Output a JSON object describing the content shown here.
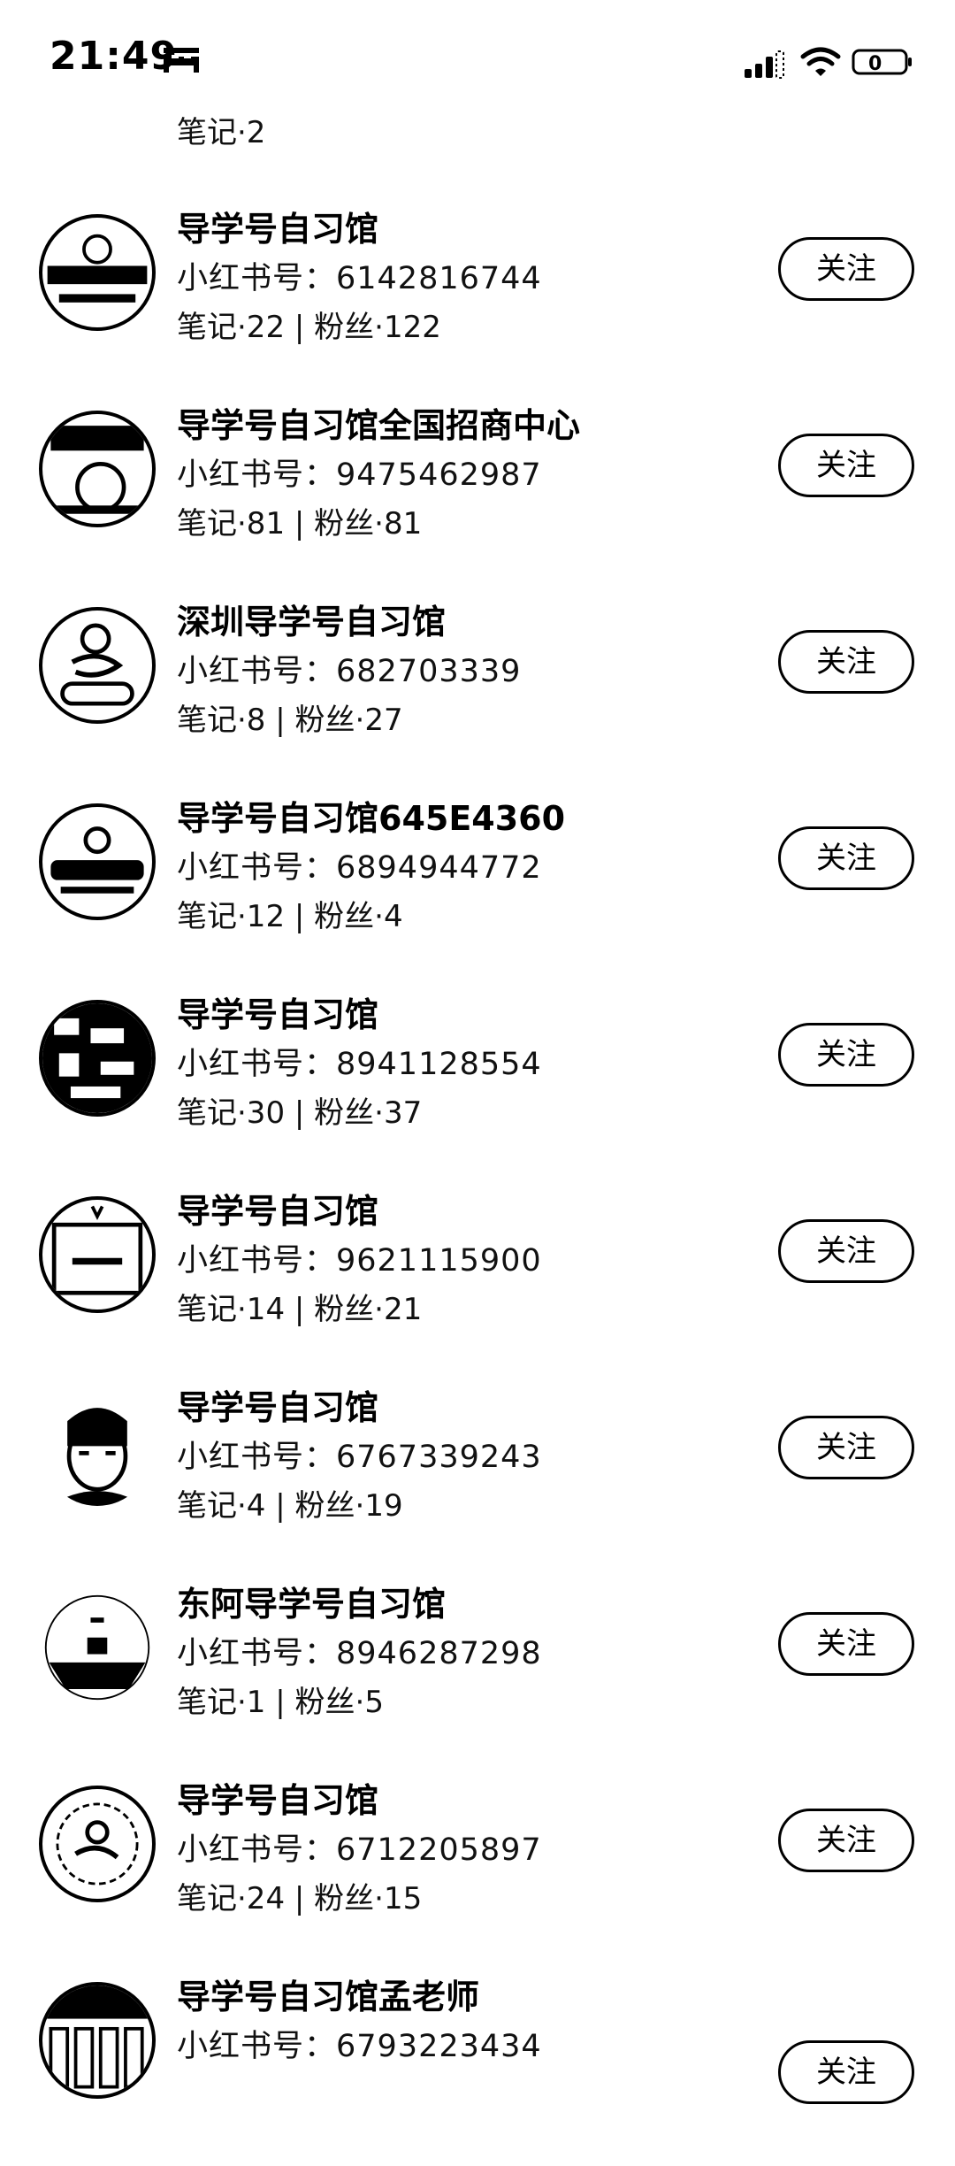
{
  "status_bar": {
    "time": "21:49",
    "battery": "0"
  },
  "partial_item": {
    "stats": "笔记·2"
  },
  "follow_label": "关注",
  "users": [
    {
      "name": "导学号自习馆",
      "red_id": "小红书号：6142816744",
      "stats": "笔记·22 | 粉丝·122"
    },
    {
      "name": "导学号自习馆全国招商中心",
      "red_id": "小红书号：9475462987",
      "stats": "笔记·81 | 粉丝·81"
    },
    {
      "name": "深圳导学号自习馆",
      "red_id": "小红书号：682703339",
      "stats": "笔记·8 | 粉丝·27"
    },
    {
      "name": "导学号自习馆645E4360",
      "red_id": "小红书号：6894944772",
      "stats": "笔记·12 | 粉丝·4"
    },
    {
      "name": "导学号自习馆",
      "red_id": "小红书号：8941128554",
      "stats": "笔记·30 | 粉丝·37"
    },
    {
      "name": "导学号自习馆",
      "red_id": "小红书号：9621115900",
      "stats": "笔记·14 | 粉丝·21"
    },
    {
      "name": "导学号自习馆",
      "red_id": "小红书号：6767339243",
      "stats": "笔记·4 | 粉丝·19"
    },
    {
      "name": "东阿导学号自习馆",
      "red_id": "小红书号：8946287298",
      "stats": "笔记·1 | 粉丝·5"
    },
    {
      "name": "导学号自习馆",
      "red_id": "小红书号：6712205897",
      "stats": "笔记·24 | 粉丝·15"
    },
    {
      "name": "导学号自习馆孟老师",
      "red_id": "小红书号：6793223434",
      "stats": ""
    }
  ]
}
